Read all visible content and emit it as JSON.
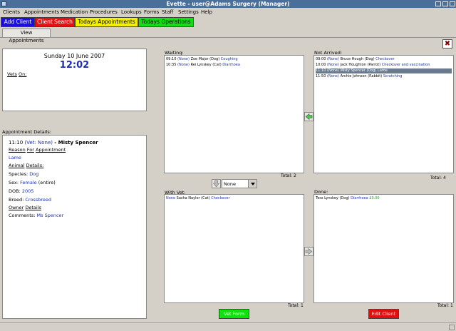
{
  "window": {
    "title": "Evette - user@Adams Surgery (Manager)"
  },
  "menu": [
    "Clients",
    "Appointments",
    "Medication",
    "Procedures",
    "Lookups",
    "Forms",
    "Staff",
    "Settings",
    "Help"
  ],
  "quick_buttons": {
    "add_client": "Add Client",
    "client_search": "Client Search",
    "todays_appointments": "Todays Appointments",
    "todays_operations": "Todays Operations"
  },
  "tab": {
    "label": "View Appointments"
  },
  "close_glyph": "✖",
  "date_panel": {
    "date": "Sunday 10 June 2007",
    "time": "12:02",
    "vets_label": "Vets",
    "on_label": "On:"
  },
  "details": {
    "header": "Appointment Details:",
    "time": "11:10",
    "vet": "(Vet: None)",
    "client": "- Misty Spencer",
    "reason_label_1": "Reason",
    "reason_label_2": "For",
    "reason_label_3": "Appointment",
    "reason": "Lame",
    "animal_label_1": "Animal",
    "animal_label_2": "Details:",
    "species_label": "Species:",
    "species": "Dog",
    "sex_label": "Sex:",
    "sex": "Female",
    "sex_extra": "(entire)",
    "dob_label": "DOB:",
    "dob": "2005",
    "breed_label": "Breed:",
    "breed": "Crossbreed",
    "owner_label_1": "Owner",
    "owner_label_2": "Details",
    "comments_label": "Comments:",
    "comments": "Ms Spencer"
  },
  "waiting": {
    "title": "Waiting:",
    "rows": [
      {
        "time": "09:10",
        "vet": "(None)",
        "name": "Zoe Major (Dog)",
        "reason": "Coughing"
      },
      {
        "time": "10:35",
        "vet": "(None)",
        "name": "Rei Lynskey (Cat)",
        "reason": "Diarrhoea"
      }
    ],
    "total": "Total: 2"
  },
  "not_arrived": {
    "title": "Not Arrived:",
    "rows": [
      {
        "time": "09:00",
        "vet": "(None)",
        "name": "Bruce Hough (Dog)",
        "reason": "Checkover"
      },
      {
        "time": "10:00",
        "vet": "(None)",
        "name": "Jack Houghton (Parrot)",
        "reason": "Checkover and vaccination"
      },
      {
        "time": "11:10",
        "vet": "(None)",
        "name": "Misty Spencer (Dog)",
        "reason": "Lame"
      },
      {
        "time": "11:50",
        "vet": "(None)",
        "name": "Archie Johnson (Rabbit)",
        "reason": "Scratching"
      }
    ],
    "total": "Total: 4"
  },
  "with_vet": {
    "title": "With Vet:",
    "rows": [
      {
        "vet": "None",
        "name": "Sasha Naylor (Cat)",
        "reason": "Checkover"
      }
    ],
    "total": "Total: 1"
  },
  "done": {
    "title": "Done:",
    "rows": [
      {
        "name": "Tess Lynskey (Dog)",
        "reason": "Diarrhoea",
        "amount": "£0.00"
      }
    ],
    "total": "Total: 1"
  },
  "vet_select": {
    "value": "None"
  },
  "bottom_buttons": {
    "vet_form": "Vet Form",
    "edit_client": "Edit Client"
  },
  "colors": {
    "add_client": "#1a10e0",
    "client_search": "#e81010",
    "todays_appointments": "#f0f000",
    "todays_operations": "#10e010",
    "vet_form": "#10e010",
    "edit_client": "#e01010",
    "title_bar": "#4a6f9a"
  }
}
